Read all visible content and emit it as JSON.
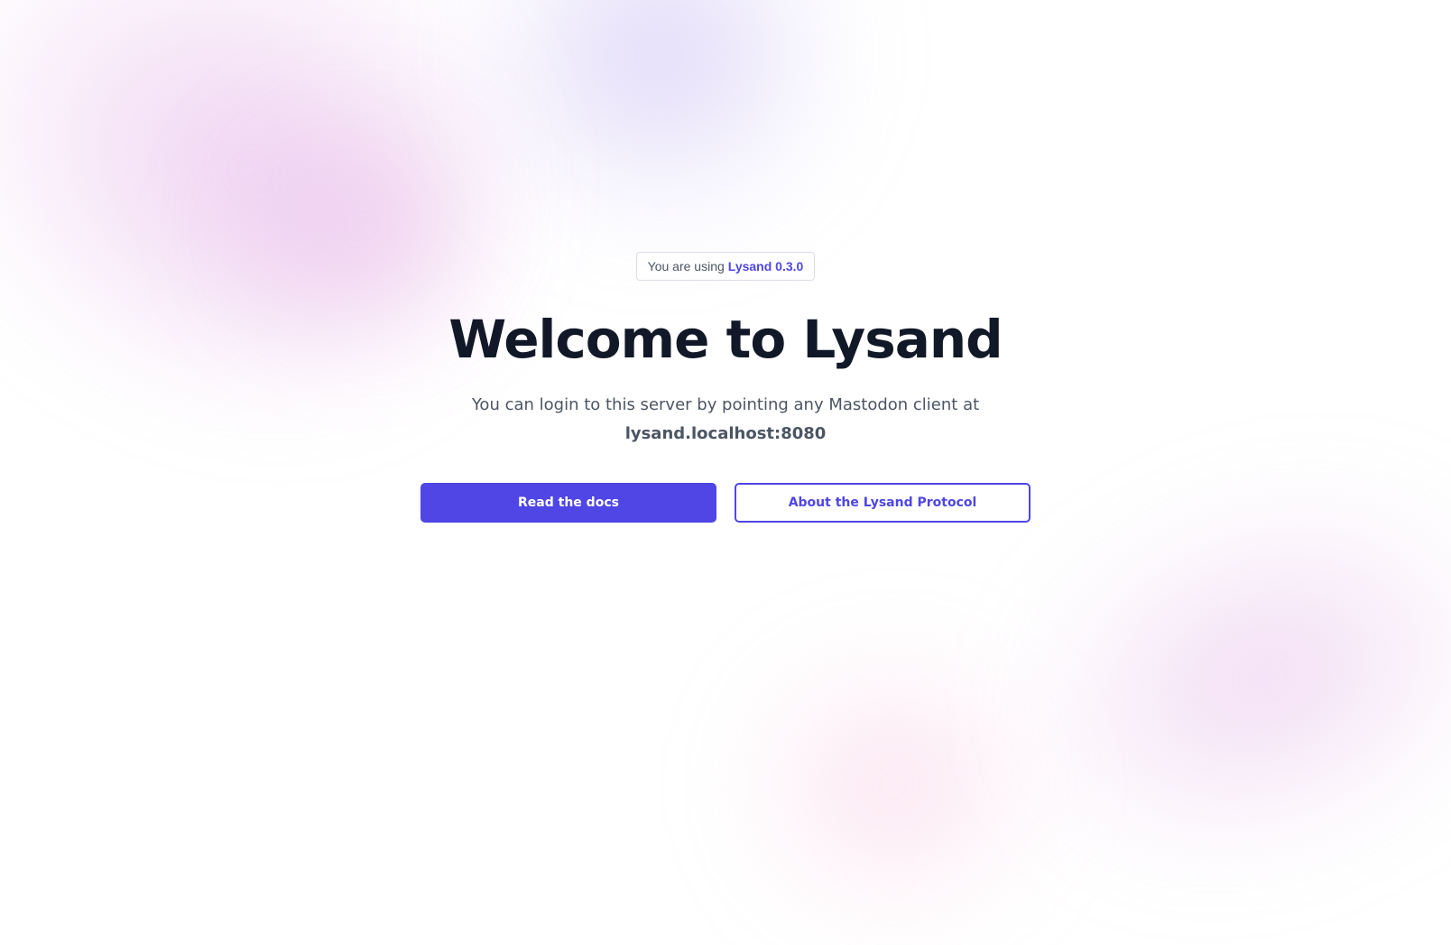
{
  "badge": {
    "prefix": "You are using",
    "version": "Lysand 0.3.0"
  },
  "hero": {
    "title": "Welcome to Lysand",
    "subtitle": "You can login to this server by pointing any Mastodon client at",
    "host": "lysand.localhost:8080"
  },
  "actions": {
    "primary_label": "Read the docs",
    "secondary_label": "About the Lysand Protocol"
  },
  "colors": {
    "accent": "#4f46e5",
    "heading": "#111827",
    "body_text": "#4b5563"
  }
}
